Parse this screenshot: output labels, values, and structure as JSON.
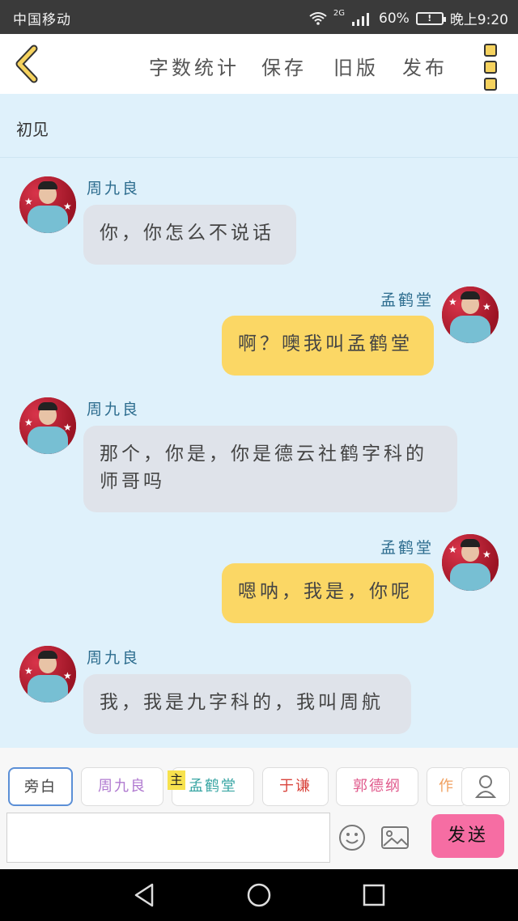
{
  "status_bar": {
    "carrier": "中国移动",
    "network": "2G",
    "battery_percent": "60%",
    "battery_icon_glyph": "!",
    "time": "晚上9:20"
  },
  "toolbar": {
    "word_count": "字数统计",
    "save": "保存",
    "old_version": "旧版",
    "publish": "发布"
  },
  "chat": {
    "title": "初见",
    "messages": [
      {
        "speaker": "周九良",
        "text": "你，你怎么不说话",
        "side": "left"
      },
      {
        "speaker": "孟鹤堂",
        "text": "啊？噢我叫孟鹤堂",
        "side": "right"
      },
      {
        "speaker": "周九良",
        "text": "那个，你是，你是德云社鹤字科的师哥吗",
        "side": "left"
      },
      {
        "speaker": "孟鹤堂",
        "text": "嗯呐，我是，你呢",
        "side": "right"
      },
      {
        "speaker": "周九良",
        "text": "我，我是九字科的，我叫周航",
        "side": "left"
      }
    ]
  },
  "roles": {
    "items": [
      {
        "label": "旁白",
        "color": "#444444"
      },
      {
        "label": "周九良",
        "color": "#b07ad0"
      },
      {
        "label": "孟鹤堂",
        "color": "#3aa6a4"
      },
      {
        "label": "于谦",
        "color": "#d9443c"
      },
      {
        "label": "郭德纲",
        "color": "#e05a8c"
      },
      {
        "label": "作",
        "color": "#f0a060"
      }
    ],
    "main_tag": "主"
  },
  "input": {
    "value": "",
    "placeholder": "",
    "send_label": "发送"
  },
  "colors": {
    "chat_bg": "#dff1fb",
    "bubble_left": "#dfe3ea",
    "bubble_right": "#fbd765",
    "send_button": "#f66da3",
    "name_color": "#2c6c8e"
  }
}
